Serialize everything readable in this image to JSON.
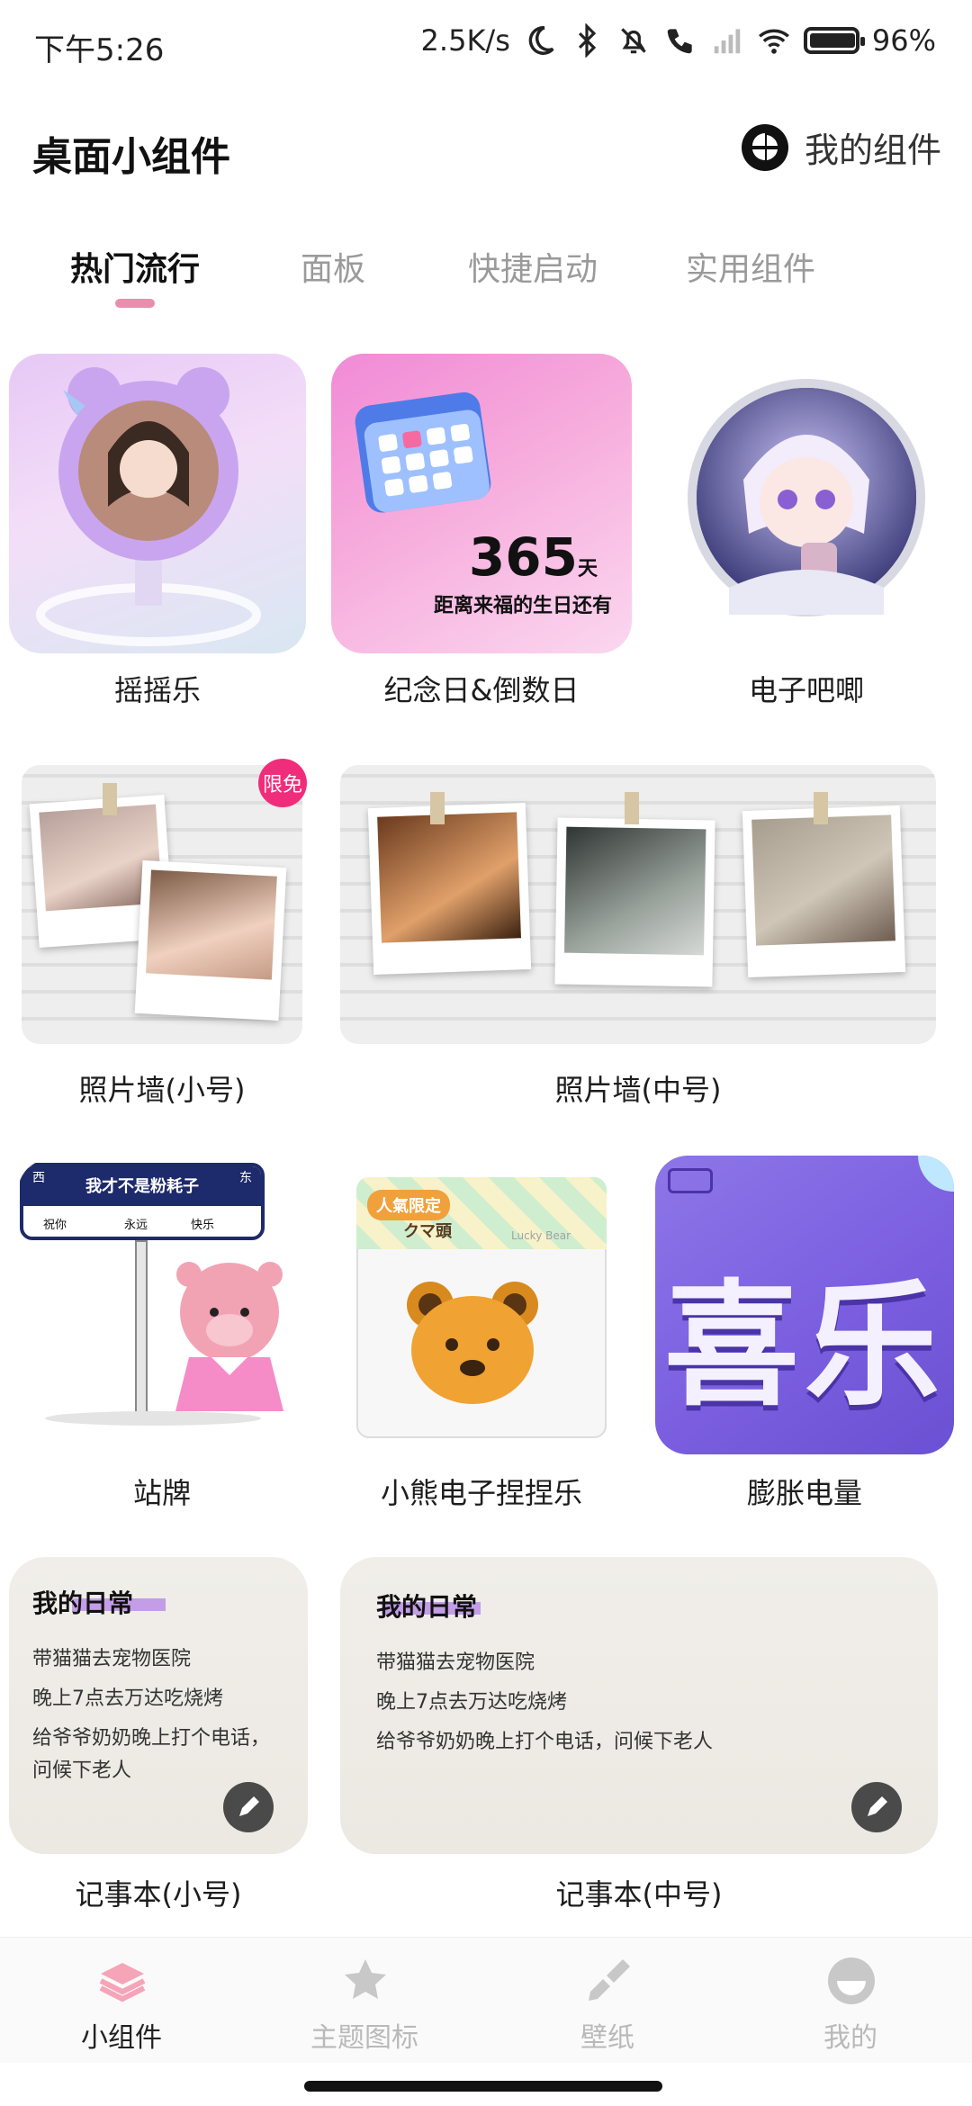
{
  "status_bar": {
    "time": "下午5:26",
    "speed": "2.5K/s",
    "battery": "96%",
    "battery_level": 0.96
  },
  "header": {
    "title": "桌面小组件",
    "my_widgets": "我的组件"
  },
  "tabs": [
    {
      "label": "热门流行",
      "active": true
    },
    {
      "label": "面板",
      "active": false
    },
    {
      "label": "快捷启动",
      "active": false
    },
    {
      "label": "实用组件",
      "active": false
    }
  ],
  "widgets": {
    "shake": {
      "label": "摇摇乐"
    },
    "countdown": {
      "label": "纪念日&倒数日",
      "number": "365",
      "unit": "天",
      "caption": "距离来福的生日还有"
    },
    "badge_pin": {
      "label": "电子吧唧"
    },
    "photo_wall_small": {
      "label": "照片墙(小号)",
      "badge": "限免"
    },
    "photo_wall_medium": {
      "label": "照片墙(中号)"
    },
    "station_sign": {
      "label": "站牌",
      "sign_title": "我才不是粉耗子",
      "west": "西",
      "east": "东",
      "stops": [
        "祝你",
        "永远",
        "快乐"
      ]
    },
    "bear": {
      "label": "小熊电子捏捏乐",
      "tag": "人氣限定",
      "tag2": "クマ頭",
      "brand": "Lucky Bear"
    },
    "battery_puffy": {
      "label": "膨胀电量",
      "text": "喜乐"
    },
    "notepad_small": {
      "label": "记事本(小号)",
      "heading": "我的日常",
      "lines": [
        "带猫猫去宠物医院",
        "晚上7点去万达吃烧烤",
        "给爷爷奶奶晚上打个电话，",
        "问候下老人"
      ]
    },
    "notepad_medium": {
      "label": "记事本(中号)",
      "heading": "我的日常",
      "lines": [
        "带猫猫去宠物医院",
        "晚上7点去万达吃烧烤",
        "给爷爷奶奶晚上打个电话，问候下老人"
      ]
    }
  },
  "bottom_nav": [
    {
      "label": "小组件",
      "icon": "layers-icon",
      "active": true
    },
    {
      "label": "主题图标",
      "icon": "star-icon",
      "active": false
    },
    {
      "label": "壁纸",
      "icon": "brush-icon",
      "active": false
    },
    {
      "label": "我的",
      "icon": "profile-icon",
      "active": false
    }
  ],
  "colors": {
    "accent": "#e98fae",
    "badge": "#f02d7a",
    "puffy": "#7b5fe0"
  }
}
